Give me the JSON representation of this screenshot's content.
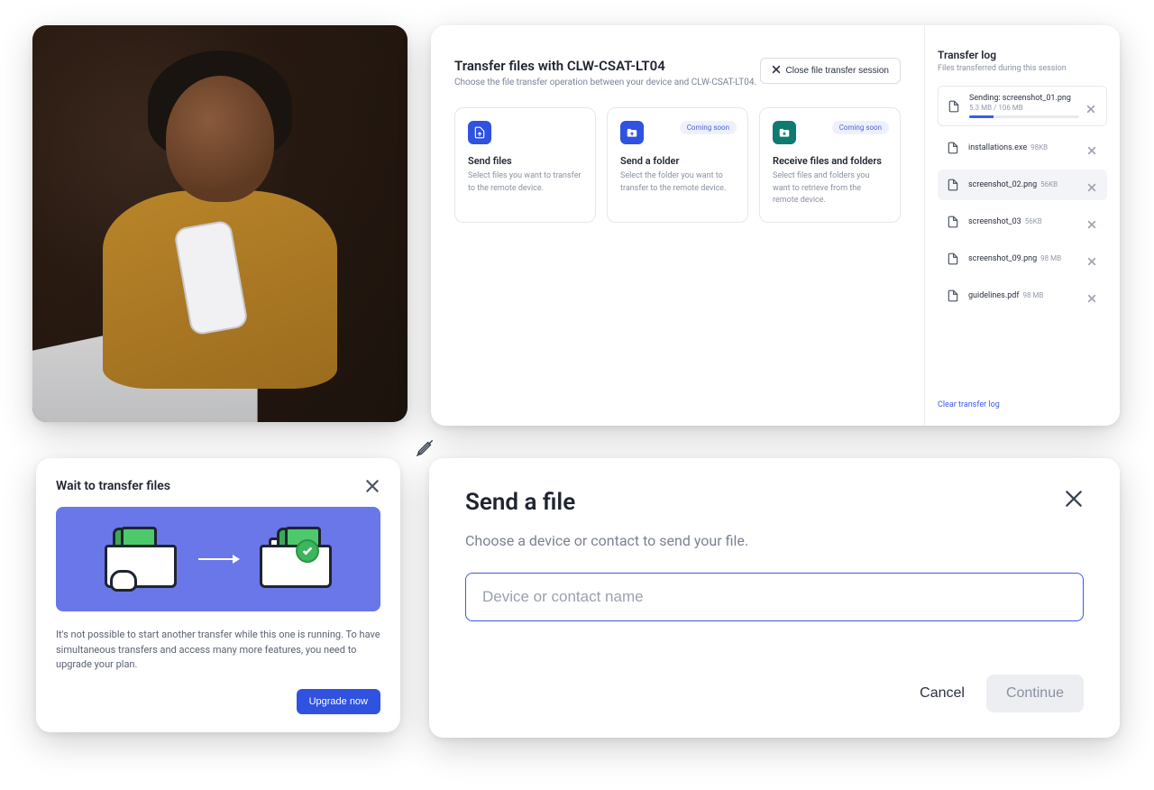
{
  "transfer": {
    "title": "Transfer files with CLW-CSAT-LT04",
    "subtitle": "Choose the file transfer operation between your device and CLW-CSAT-LT04.",
    "close_label": "Close file transfer session",
    "cards": [
      {
        "icon": "file-upload-icon",
        "title": "Send files",
        "desc": "Select files you want to transfer to the remote device.",
        "coming_soon": false,
        "accent": "blue"
      },
      {
        "icon": "folder-upload-icon",
        "title": "Send a folder",
        "desc": "Select the folder you want to transfer to the remote device.",
        "coming_soon": true,
        "coming_soon_label": "Coming soon",
        "accent": "blue"
      },
      {
        "icon": "folder-download-icon",
        "title": "Receive files and folders",
        "desc": "Select files and folders you want to retrieve from the remote device.",
        "coming_soon": true,
        "coming_soon_label": "Coming soon",
        "accent": "teal"
      }
    ],
    "log": {
      "title": "Transfer log",
      "subtitle": "Files transferred during this session",
      "clear_label": "Clear transfer log",
      "items": [
        {
          "name": "Sending: screenshot_01.png",
          "meta": "5.3 MB / 106 MB",
          "size": "",
          "sending": true,
          "highlight": false,
          "bordered": true,
          "progress_pct": 22
        },
        {
          "name": "installations.exe",
          "meta": "",
          "size": "98KB",
          "sending": false,
          "highlight": false,
          "bordered": false
        },
        {
          "name": "screenshot_02.png",
          "meta": "",
          "size": "56KB",
          "sending": false,
          "highlight": true,
          "bordered": false
        },
        {
          "name": "screenshot_03",
          "meta": "",
          "size": "56KB",
          "sending": false,
          "highlight": false,
          "bordered": false
        },
        {
          "name": "screenshot_09.png",
          "meta": "",
          "size": "98 MB",
          "sending": false,
          "highlight": false,
          "bordered": false
        },
        {
          "name": "guidelines.pdf",
          "meta": "",
          "size": "98 MB",
          "sending": false,
          "highlight": false,
          "bordered": false
        }
      ]
    }
  },
  "wait_modal": {
    "title": "Wait to transfer files",
    "body": "It's not possible to start another transfer while this one is running. To have simultaneous transfers and access many more features, you need to upgrade your plan.",
    "button": "Upgrade now"
  },
  "send_modal": {
    "title": "Send a file",
    "subtitle": "Choose a device or contact to send your file.",
    "placeholder": "Device or contact name",
    "cancel": "Cancel",
    "continue": "Continue"
  }
}
